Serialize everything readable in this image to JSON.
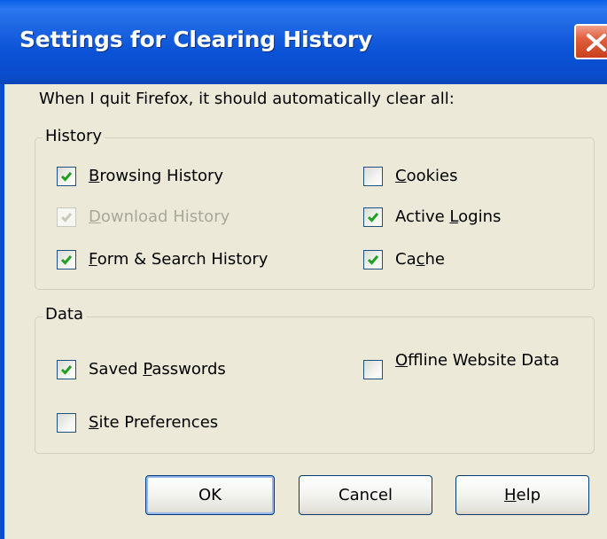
{
  "window": {
    "title": "Settings for Clearing History",
    "close_icon": "close-icon",
    "colors": {
      "titlebar": "#0a52d6",
      "body": "#ece9d8",
      "close": "#e0603f",
      "check": "#21a121"
    }
  },
  "intro": "When I quit Firefox, it should automatically clear all:",
  "history_group": {
    "legend": "History",
    "items": [
      {
        "pre": "",
        "key": "B",
        "post": "rowsing History",
        "checked": true,
        "enabled": true
      },
      {
        "pre": "",
        "key": "D",
        "post": "ownload History",
        "checked": true,
        "enabled": false
      },
      {
        "pre": "",
        "key": "F",
        "post": "orm & Search History",
        "checked": true,
        "enabled": true
      },
      {
        "pre": "",
        "key": "C",
        "post": "ookies",
        "checked": false,
        "enabled": true
      },
      {
        "pre": "Active ",
        "key": "L",
        "post": "ogins",
        "checked": true,
        "enabled": true
      },
      {
        "pre": "Ca",
        "key": "c",
        "post": "he",
        "checked": true,
        "enabled": true
      }
    ]
  },
  "data_group": {
    "legend": "Data",
    "items": [
      {
        "pre": "Saved ",
        "key": "P",
        "post": "asswords",
        "checked": true,
        "enabled": true
      },
      {
        "pre": "",
        "key": "S",
        "post": "ite Preferences",
        "checked": false,
        "enabled": true
      },
      {
        "pre": "",
        "key": "O",
        "post": "ffline Website Data",
        "checked": false,
        "enabled": true
      }
    ]
  },
  "buttons": {
    "ok": {
      "label": "OK"
    },
    "cancel": {
      "label": "Cancel"
    },
    "help": {
      "pre": "",
      "key": "H",
      "post": "elp"
    }
  }
}
